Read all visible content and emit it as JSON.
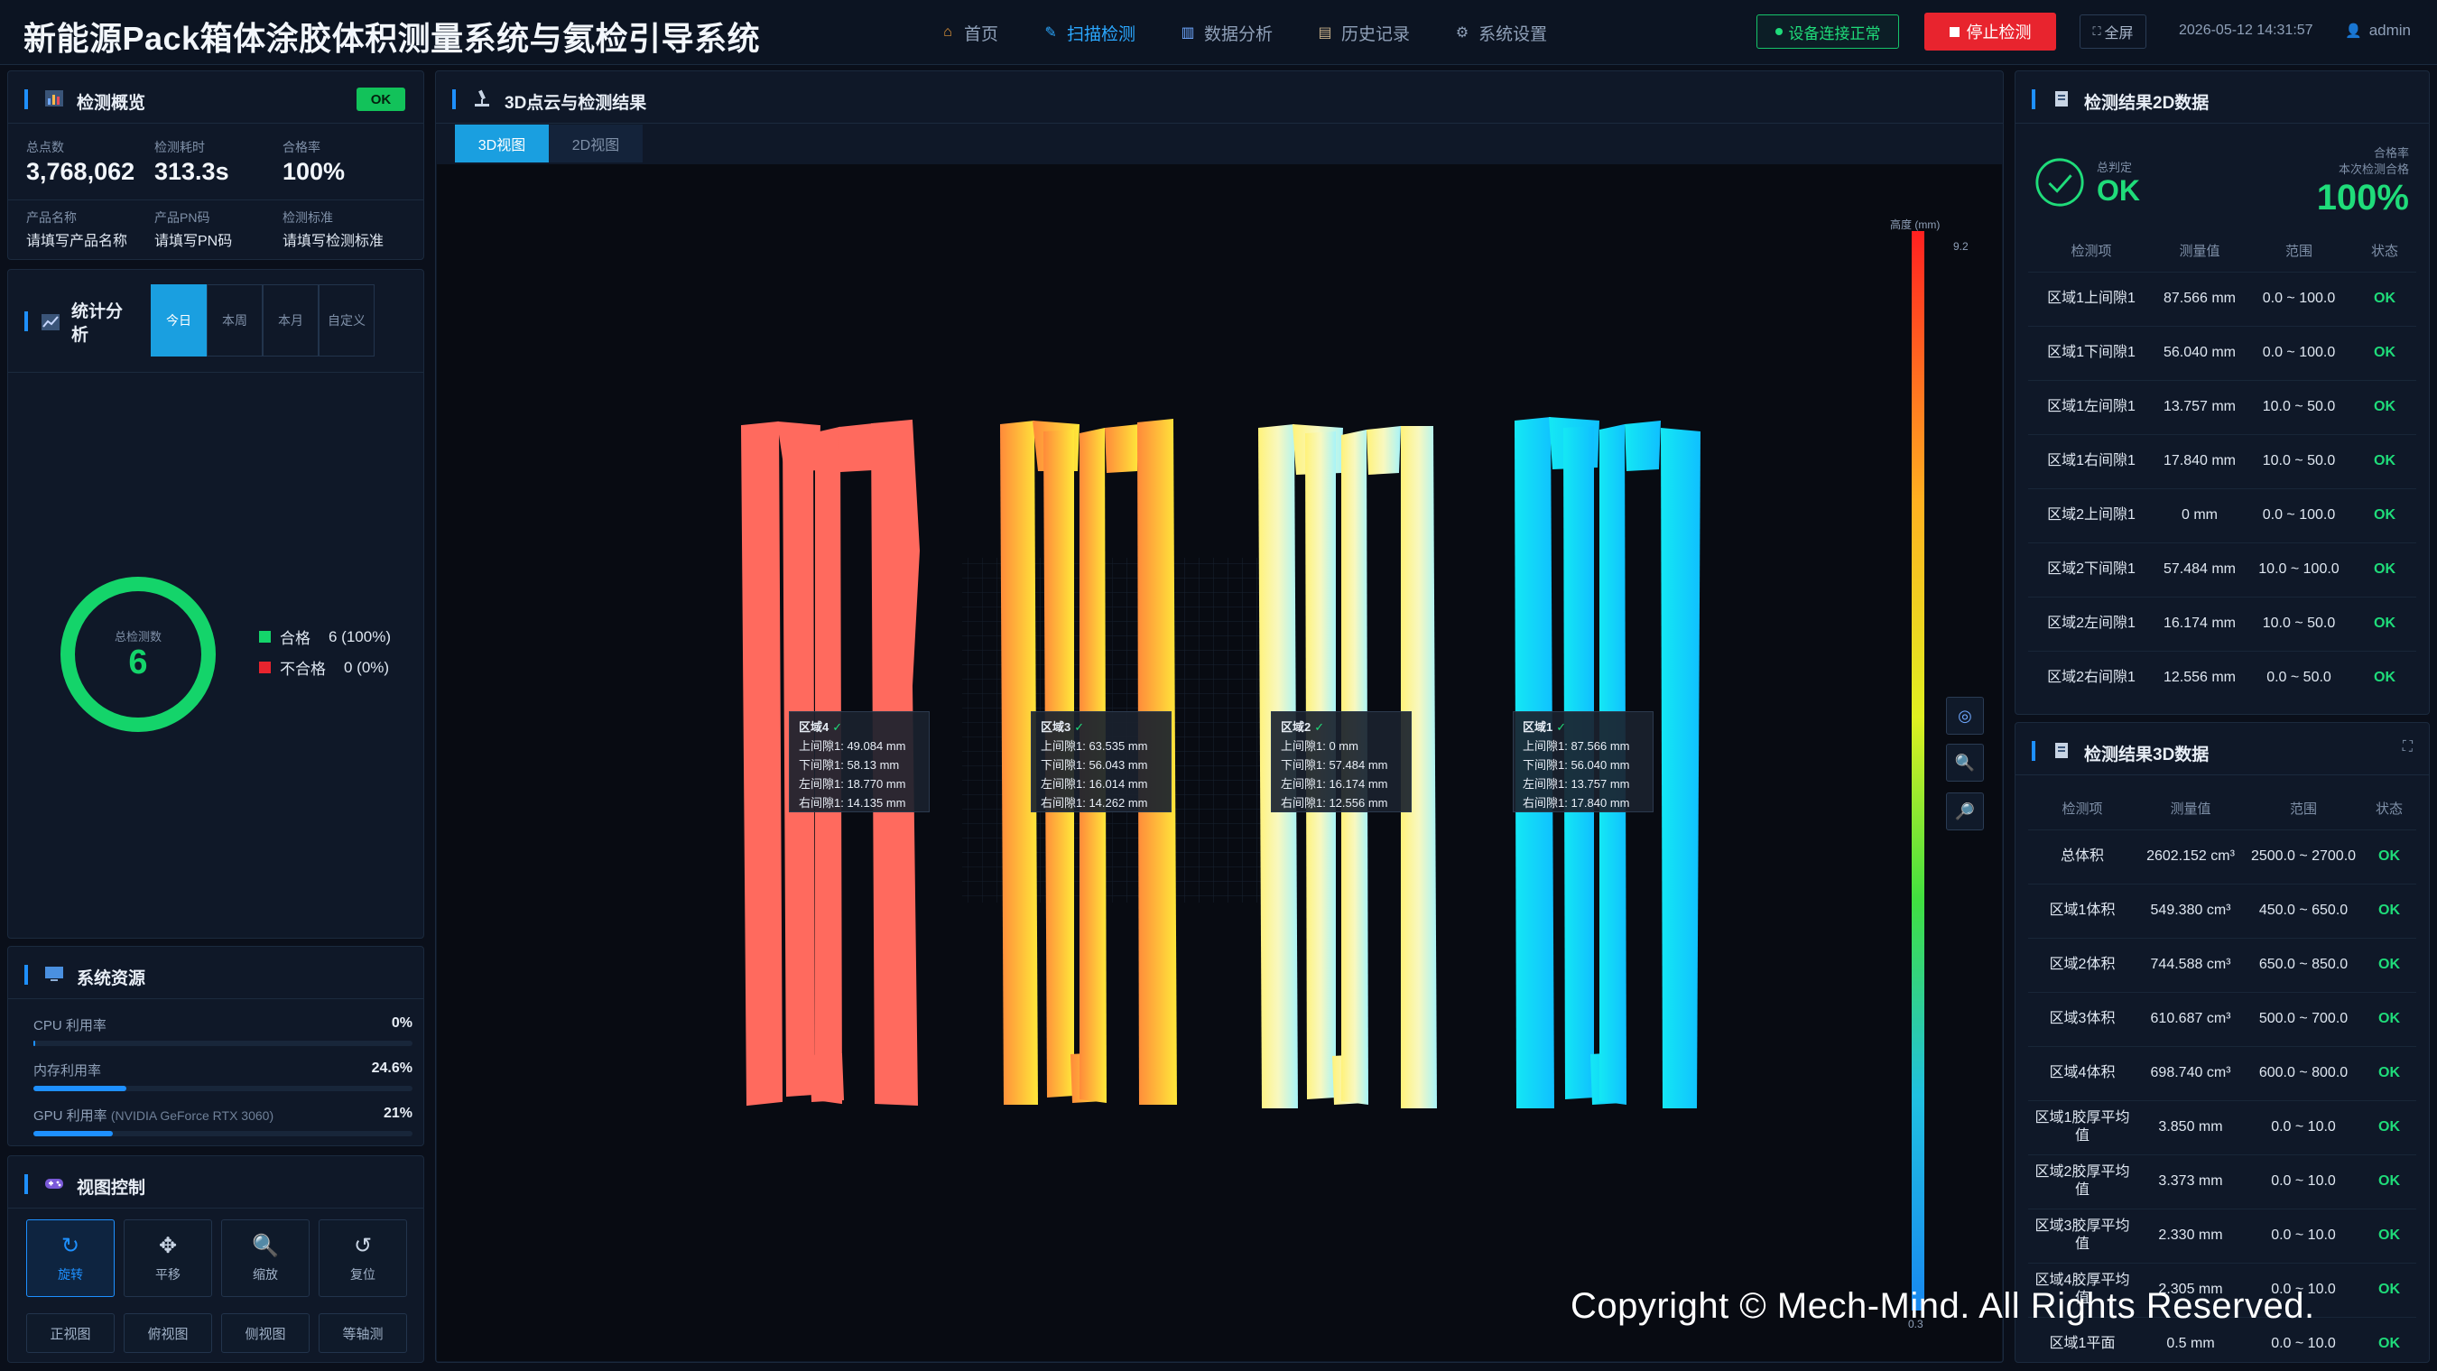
{
  "app": {
    "title": "新能源Pack箱体涂胶体积测量系统与氦检引导系统"
  },
  "nav": [
    {
      "label": "首页",
      "icon": "home-icon"
    },
    {
      "label": "扫描检测",
      "icon": "scan-icon"
    },
    {
      "label": "数据分析",
      "icon": "chart-icon"
    },
    {
      "label": "历史记录",
      "icon": "history-icon"
    },
    {
      "label": "系统设置",
      "icon": "gear-icon"
    }
  ],
  "header": {
    "device_status": "设备连接正常",
    "stop_label": "停止检测",
    "fullscreen_label": "全屏",
    "datetime": "2026-05-12 14:31:57",
    "user": "admin"
  },
  "overview": {
    "title": "检测概览",
    "badge": "OK",
    "points_label": "总点数",
    "points": "3,768,062",
    "time_label": "检测耗时",
    "time": "313.3s",
    "rate_label": "合格率",
    "rate": "100%",
    "product_label": "产品名称",
    "product": "请填写产品名称",
    "pn_label": "产品PN码",
    "pn": "请填写PN码",
    "std_label": "检测标准",
    "std": "请填写检测标准"
  },
  "stats": {
    "title": "统计分析",
    "periods": [
      "今日",
      "本周",
      "本月",
      "自定义"
    ],
    "ring_label": "总检测数",
    "total": "6",
    "pass_label": "合格",
    "pass_count": "6 (100%)",
    "fail_label": "不合格",
    "fail_count": "0 (0%)",
    "pass_fraction": 1.0,
    "pass_color": "#14d46a",
    "fail_color": "#e8242e"
  },
  "resources": {
    "title": "系统资源",
    "items": [
      {
        "label": "CPU 利用率",
        "sub": "",
        "pct": "0%",
        "value": 0
      },
      {
        "label": "内存利用率",
        "sub": "",
        "pct": "24.6%",
        "value": 24.6
      },
      {
        "label": "GPU 利用率",
        "sub": "(NVIDIA GeForce RTX 3060)",
        "pct": "21%",
        "value": 21
      }
    ]
  },
  "view_control": {
    "title": "视图控制",
    "modes": [
      {
        "label": "旋转",
        "icon": "rotate-icon"
      },
      {
        "label": "平移",
        "icon": "move-icon"
      },
      {
        "label": "缩放",
        "icon": "zoom-icon"
      },
      {
        "label": "复位",
        "icon": "reset-icon"
      }
    ],
    "views": [
      "正视图",
      "俯视图",
      "侧视图",
      "等轴测"
    ]
  },
  "center": {
    "title": "3D点云与检测结果",
    "tabs": [
      "3D视图",
      "2D视图"
    ],
    "colorbar_title": "高度 (mm)",
    "colorbar_max": "9.2",
    "colorbar_min": "0.3",
    "regions": [
      {
        "name": "区域4",
        "lines": [
          "上间隙1: 49.084 mm",
          "下间隙1: 58.13 mm",
          "左间隙1: 18.770 mm",
          "右间隙1: 14.135 mm"
        ]
      },
      {
        "name": "区域3",
        "lines": [
          "上间隙1: 63.535 mm",
          "下间隙1: 56.043 mm",
          "左间隙1: 16.014 mm",
          "右间隙1: 14.262 mm"
        ]
      },
      {
        "name": "区域2",
        "lines": [
          "上间隙1: 0 mm",
          "下间隙1: 57.484 mm",
          "左间隙1: 16.174 mm",
          "右间隙1: 12.556 mm"
        ]
      },
      {
        "name": "区域1",
        "lines": [
          "上间隙1: 87.566 mm",
          "下间隙1: 56.040 mm",
          "左间隙1: 13.757 mm",
          "右间隙1: 17.840 mm"
        ]
      }
    ]
  },
  "result2d": {
    "title": "检测结果2D数据",
    "verdict_label": "总判定",
    "verdict": "OK",
    "rate_label": "合格率",
    "rate_sub": "本次检测合格",
    "rate": "100%",
    "headers": [
      "检测项",
      "测量值",
      "范围",
      "状态"
    ],
    "rows": [
      [
        "区域1上间隙1",
        "87.566 mm",
        "0.0 ~ 100.0",
        "OK"
      ],
      [
        "区域1下间隙1",
        "56.040 mm",
        "0.0 ~ 100.0",
        "OK"
      ],
      [
        "区域1左间隙1",
        "13.757 mm",
        "10.0 ~ 50.0",
        "OK"
      ],
      [
        "区域1右间隙1",
        "17.840 mm",
        "10.0 ~ 50.0",
        "OK"
      ],
      [
        "区域2上间隙1",
        "0 mm",
        "0.0 ~ 100.0",
        "OK"
      ],
      [
        "区域2下间隙1",
        "57.484 mm",
        "10.0 ~ 100.0",
        "OK"
      ],
      [
        "区域2左间隙1",
        "16.174 mm",
        "10.0 ~ 50.0",
        "OK"
      ],
      [
        "区域2右间隙1",
        "12.556 mm",
        "0.0 ~ 50.0",
        "OK"
      ]
    ]
  },
  "result3d": {
    "title": "检测结果3D数据",
    "headers": [
      "检测项",
      "测量值",
      "范围",
      "状态"
    ],
    "rows": [
      [
        "总体积",
        "2602.152 cm³",
        "2500.0 ~ 2700.0",
        "OK"
      ],
      [
        "区域1体积",
        "549.380 cm³",
        "450.0 ~ 650.0",
        "OK"
      ],
      [
        "区域2体积",
        "744.588 cm³",
        "650.0 ~ 850.0",
        "OK"
      ],
      [
        "区域3体积",
        "610.687 cm³",
        "500.0 ~ 700.0",
        "OK"
      ],
      [
        "区域4体积",
        "698.740 cm³",
        "600.0 ~ 800.0",
        "OK"
      ],
      [
        "区域1胶厚平均值",
        "3.850 mm",
        "0.0 ~ 10.0",
        "OK"
      ],
      [
        "区域2胶厚平均值",
        "3.373 mm",
        "0.0 ~ 10.0",
        "OK"
      ],
      [
        "区域3胶厚平均值",
        "2.330 mm",
        "0.0 ~ 10.0",
        "OK"
      ],
      [
        "区域4胶厚平均值",
        "2.305 mm",
        "0.0 ~ 10.0",
        "OK"
      ],
      [
        "区域1平面",
        "0.5 mm",
        "0.0 ~ 10.0",
        "OK"
      ]
    ]
  },
  "copyright": "Copyright © Mech-Mind. All Rights Reserved."
}
